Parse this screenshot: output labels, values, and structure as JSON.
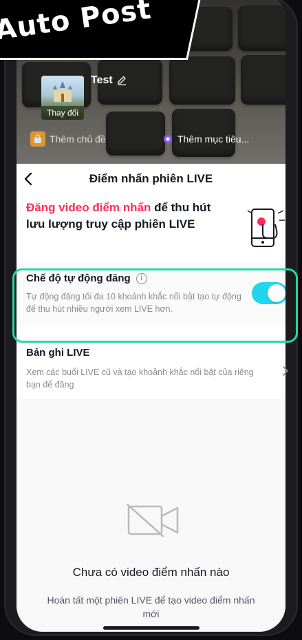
{
  "overlay": {
    "label": "Auto Post"
  },
  "banner": {
    "title": "Test",
    "change_label": "Thay đổi",
    "chips": [
      {
        "label": "Thêm chủ đề",
        "icon": "shopping-bag-icon",
        "color": "#f5a623"
      },
      {
        "label": "Thêm mục tiêu...",
        "icon": "target-icon",
        "color": "#8a5cf6"
      }
    ]
  },
  "header": {
    "title": "Điểm nhấn phiên LIVE"
  },
  "promo": {
    "accent": "Đăng video điểm nhấn",
    "rest": " để thu hút lưu lượng truy cập phiên LIVE"
  },
  "auto_post": {
    "title": "Chế độ tự động đăng",
    "description": "Tự động đăng tối đa 10 khoảnh khắc nổi bật tạo tự động để thu hút nhiều người xem LIVE hơn.",
    "enabled": true,
    "accent_color": "#20d5ec"
  },
  "live_record": {
    "title": "Bản ghi LIVE",
    "description": "Xem các buổi LIVE cũ và tạo khoảnh khắc nổi bật của riêng bạn để đăng"
  },
  "empty_state": {
    "title": "Chưa có video điểm nhấn nào",
    "description": "Hoàn tất một phiên LIVE để tạo video điểm nhấn mới"
  },
  "colors": {
    "accent": "#fe2c55",
    "highlight_border": "#23d9a2"
  }
}
